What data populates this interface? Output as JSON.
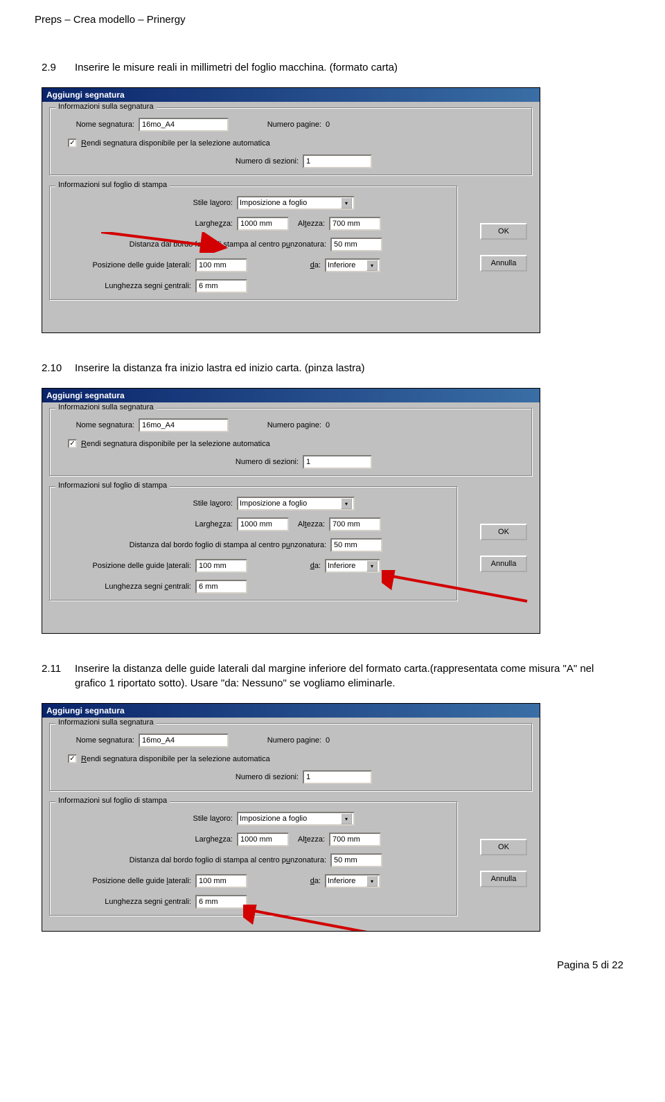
{
  "doc": {
    "header": "Preps – Crea modello – Prinergy",
    "footer": "Pagina 5 di 22"
  },
  "steps": {
    "s1": {
      "num": "2.9",
      "text": "Inserire le misure reali in millimetri del foglio macchina. (formato carta)"
    },
    "s2": {
      "num": "2.10",
      "text": "Inserire la distanza fra inizio lastra ed inizio carta. (pinza lastra)"
    },
    "s3": {
      "num": "2.11",
      "text": "Inserire la distanza delle guide laterali dal margine inferiore del formato carta.(rappresentata come misura \"A\" nel grafico 1 riportato sotto). Usare \"da: Nessuno\" se vogliamo eliminarle."
    }
  },
  "dialog": {
    "title": "Aggiungi segnatura",
    "group1": "Informazioni sulla segnatura",
    "group2": "Informazioni sul foglio di stampa",
    "labels": {
      "nome_segnatura": "Nome segnatura:",
      "numero_pagine": "Numero pagine:",
      "numero_pagine_val": "0",
      "rendi": "Rendi segnatura disponibile per la selezione automatica",
      "numero_sezioni": "Numero di sezioni:",
      "stile_lavoro": "Stile lavoro:",
      "larghezza": "Larghezza:",
      "altezza": "Altezza:",
      "distanza_bordo": "Distanza dal bordo foglio di stampa al centro punzonatura:",
      "posizione_guide": "Posizione delle guide laterali:",
      "da": "da:",
      "lunghezza_segni": "Lunghezza segni centrali:"
    },
    "values": {
      "nome_segnatura": "16mo_A4",
      "numero_sezioni": "1",
      "stile_lavoro": "Imposizione a foglio",
      "larghezza": "1000 mm",
      "altezza": "700 mm",
      "distanza_bordo": "50 mm",
      "posizione_guide": "100 mm",
      "da": "Inferiore",
      "lunghezza_segni": "6 mm"
    },
    "buttons": {
      "ok": "OK",
      "annulla": "Annulla"
    }
  }
}
